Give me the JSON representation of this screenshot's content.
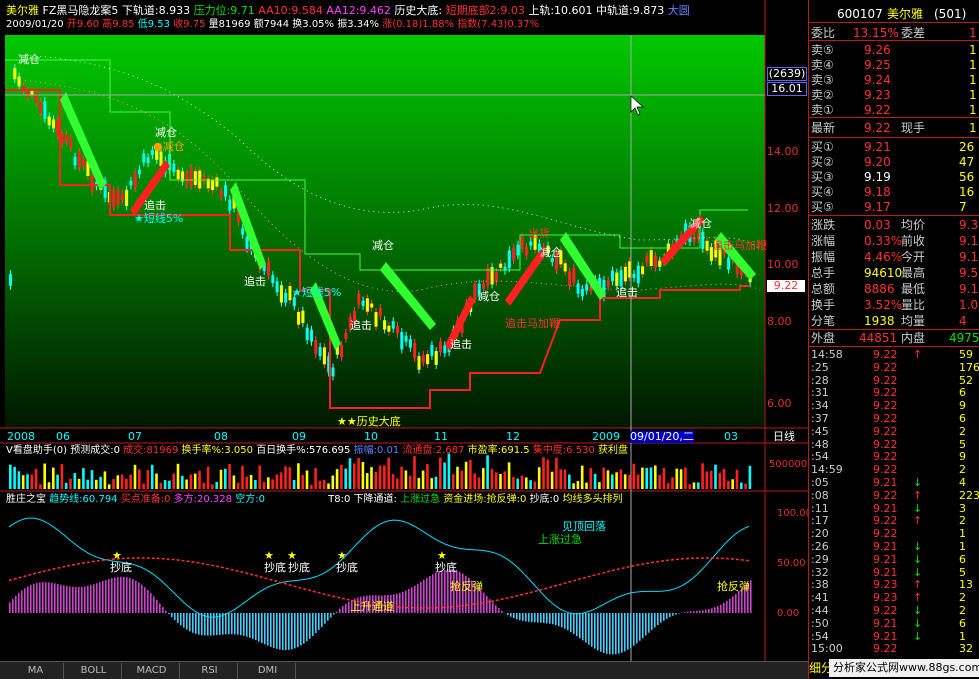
{
  "main_header": {
    "stock_name": "美尔雅",
    "indicator": "FZ黑马隐龙案5",
    "lower_rail": "下轨道:8.933",
    "pressure": "压力位:9.71",
    "aa10": "AA10:9.584",
    "aa12": "AA12:9.462",
    "hist_bottom": "历史大底:",
    "short_bottom": "短期底部2:9.03",
    "upper_rail": "上轨:10.601",
    "mid_rail": "中轨道:9.873",
    "tag_big": "大圆",
    "date": "2009/01/20",
    "open": "开9.60",
    "high": "高9.85",
    "low": "低9.53",
    "close": "收9.75",
    "vol": "量81969",
    "amt": "额7944",
    "turn": "换3.05%",
    "amp": "振3.34%",
    "chg": "涨(0.18)1.88%",
    "index": "指数(7.43)0.37%"
  },
  "chart_labels": {
    "reduce": "减仓",
    "chase": "追击",
    "short_line": "★短线5%",
    "hist_bottom_star": "★★历史大底",
    "ship_out": "出货",
    "cycle_hint": "追击马加鞭",
    "rebound": "抢反弹",
    "bottom_pick": "抄底",
    "ascend_channel": "上升通道",
    "peak_exit": "见顶回落",
    "up_accel": "上涨过急"
  },
  "price_axis": [
    "16.01",
    "14.00",
    "12.00",
    "10.00",
    "8.00",
    "6.00"
  ],
  "price_tag_top": "(2639)",
  "price_tag_cur": "9.22",
  "time_axis": [
    "2008",
    "06",
    "07",
    "08",
    "09",
    "10",
    "11",
    "12",
    "2009",
    "09/01/20,二",
    "03"
  ],
  "period": "日线",
  "vol_header": {
    "name": "V看盘助手(0)",
    "forecast": "预测成交:0",
    "vol": "成交:81969",
    "turn": "换手率%:3.050",
    "hundred": "百日换手%:576.695",
    "ratio": "振幅:0.01",
    "float": "流通盘:2.687",
    "pe": "市盈率:691.5",
    "conc": "集中度:6.530",
    "profit": "获利盘"
  },
  "vol_axis": [
    "500000"
  ],
  "ind_header": {
    "name": "胜庄之宝",
    "trend": "趋势线:60.794",
    "buy": "买点准备:0",
    "long": "多方:20.328",
    "short": "空方:0",
    "t8": "T8:0",
    "down_chan": "下降通道:",
    "up_fast": "上涨过急",
    "capital": "资金进场:抢反弹:0",
    "bottom": "抄底:0",
    "ma_long": "均线多头排列"
  },
  "ind_axis": [
    "100.00",
    "50.00",
    "0.00"
  ],
  "tabs": [
    "MA",
    "BOLL",
    "MACD",
    "RSI",
    "DMI"
  ],
  "quote": {
    "code": "600107",
    "name": "美尔雅",
    "suffix": "(501)",
    "wei_bi_label": "委比",
    "wei_bi": "13.15%",
    "wei_cha_label": "委差",
    "wei_cha": "1",
    "asks": [
      {
        "l": "卖⑤",
        "p": "9.26",
        "v": "1"
      },
      {
        "l": "卖④",
        "p": "9.25",
        "v": "1"
      },
      {
        "l": "卖③",
        "p": "9.24",
        "v": "1"
      },
      {
        "l": "卖②",
        "p": "9.23",
        "v": "1"
      },
      {
        "l": "卖①",
        "p": "9.22",
        "v": "1"
      }
    ],
    "last_label": "最新",
    "last": "9.22",
    "hand_label": "现手",
    "hand": "1",
    "bids": [
      {
        "l": "买①",
        "p": "9.21",
        "v": "26"
      },
      {
        "l": "买②",
        "p": "9.20",
        "v": "47"
      },
      {
        "l": "买③",
        "p": "9.19",
        "v": "56"
      },
      {
        "l": "买④",
        "p": "9.18",
        "v": "16"
      },
      {
        "l": "买⑤",
        "p": "9.17",
        "v": "7"
      }
    ],
    "stats": [
      {
        "a": "涨跌",
        "av": "0.03",
        "b": "均价",
        "bv": "9.3"
      },
      {
        "a": "涨幅",
        "av": "0.33%",
        "b": "前收",
        "bv": "9.1"
      },
      {
        "a": "振幅",
        "av": "4.46%",
        "b": "今开",
        "bv": "9.1"
      },
      {
        "a": "总手",
        "av": "94610",
        "b": "最高",
        "bv": "9.5"
      },
      {
        "a": "总额",
        "av": "8886",
        "b": "最低",
        "bv": "9.1"
      },
      {
        "a": "换手",
        "av": "3.52%",
        "b": "量比",
        "bv": "1.0"
      },
      {
        "a": "分笔",
        "av": "1938",
        "b": "均量",
        "bv": "4"
      }
    ],
    "outer_label": "外盘",
    "outer": "44851",
    "inner_label": "内盘",
    "inner": "4975"
  },
  "ticks": [
    {
      "t": "14:58",
      "p": "9.22",
      "d": "↑",
      "v": "59"
    },
    {
      "t": ":25",
      "p": "9.22",
      "d": "",
      "v": "176"
    },
    {
      "t": ":28",
      "p": "9.22",
      "d": "",
      "v": "52"
    },
    {
      "t": ":31",
      "p": "9.22",
      "d": "",
      "v": "6"
    },
    {
      "t": ":34",
      "p": "9.22",
      "d": "",
      "v": "9"
    },
    {
      "t": ":37",
      "p": "9.22",
      "d": "",
      "v": "6"
    },
    {
      "t": ":45",
      "p": "9.22",
      "d": "",
      "v": "2"
    },
    {
      "t": ":48",
      "p": "9.22",
      "d": "",
      "v": "5"
    },
    {
      "t": ":54",
      "p": "9.22",
      "d": "",
      "v": "9"
    },
    {
      "t": "14:59",
      "p": "9.22",
      "d": "",
      "v": "2"
    },
    {
      "t": ":05",
      "p": "9.21",
      "d": "↓",
      "v": "4"
    },
    {
      "t": ":08",
      "p": "9.22",
      "d": "↑",
      "v": "223"
    },
    {
      "t": ":11",
      "p": "9.21",
      "d": "↓",
      "v": "3"
    },
    {
      "t": ":17",
      "p": "9.22",
      "d": "↑",
      "v": "2"
    },
    {
      "t": ":20",
      "p": "9.22",
      "d": "",
      "v": "1"
    },
    {
      "t": ":26",
      "p": "9.21",
      "d": "↓",
      "v": "1"
    },
    {
      "t": ":29",
      "p": "9.21",
      "d": "↓",
      "v": "6"
    },
    {
      "t": ":32",
      "p": "9.21",
      "d": "↓",
      "v": "5"
    },
    {
      "t": ":38",
      "p": "9.23",
      "d": "↑",
      "v": "13"
    },
    {
      "t": ":41",
      "p": "9.23",
      "d": "↑",
      "v": "2"
    },
    {
      "t": ":44",
      "p": "9.22",
      "d": "↓",
      "v": "2"
    },
    {
      "t": ":50",
      "p": "9.21",
      "d": "↓",
      "v": "6"
    },
    {
      "t": ":54",
      "p": "9.21",
      "d": "↓",
      "v": "1"
    },
    {
      "t": "15:00",
      "p": "9.22",
      "d": "",
      "v": "32"
    }
  ],
  "footer": {
    "detail": "细分",
    "watermark": "分析家公式网www.88gs.com"
  }
}
